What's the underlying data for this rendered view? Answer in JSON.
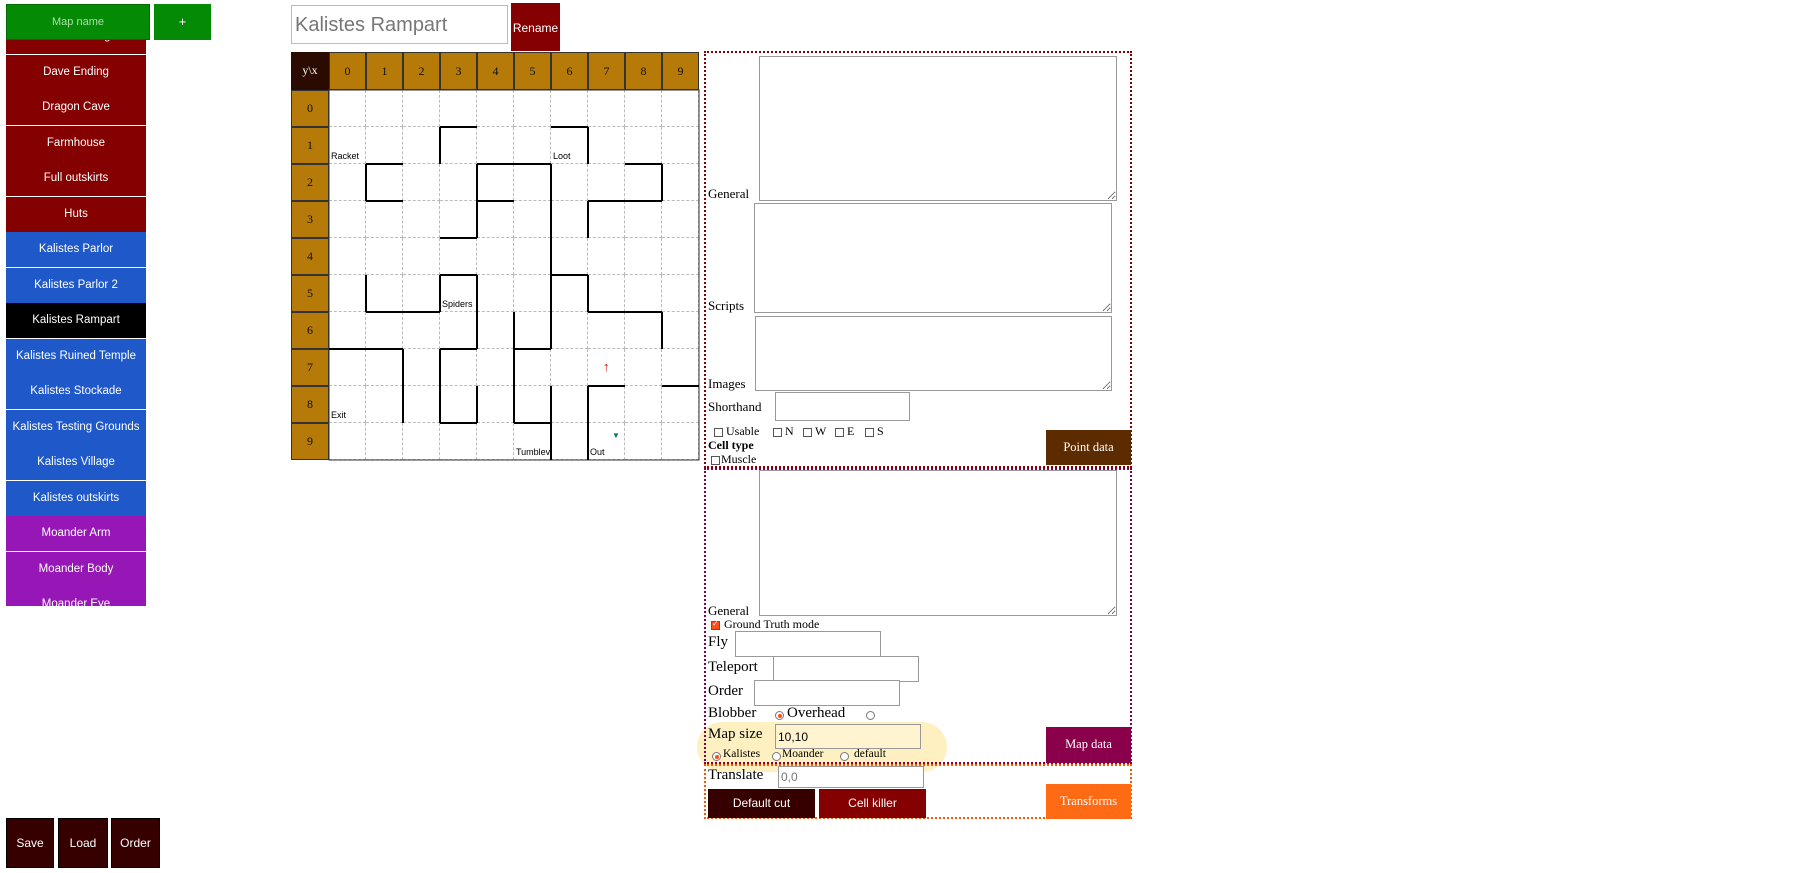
{
  "header": {
    "map_name_placeholder": "Map name",
    "add_label": "+",
    "map_title": "Kalistes Rampart",
    "rename_label": "Rename"
  },
  "map_list": [
    {
      "label": "Dave Challenge",
      "color": "red"
    },
    {
      "label": "Dave Ending",
      "color": "red"
    },
    {
      "label": "Dragon Cave",
      "color": "red"
    },
    {
      "label": "Farmhouse",
      "color": "red"
    },
    {
      "label": "Full outskirts",
      "color": "red"
    },
    {
      "label": "Huts",
      "color": "red"
    },
    {
      "label": "Kalistes Parlor",
      "color": "blue"
    },
    {
      "label": "Kalistes Parlor 2",
      "color": "blue"
    },
    {
      "label": "Kalistes Rampart",
      "color": "black",
      "selected": true
    },
    {
      "label": "Kalistes Ruined Temple",
      "color": "blue"
    },
    {
      "label": "Kalistes Stockade",
      "color": "blue"
    },
    {
      "label": "Kalistes Testing Grounds",
      "color": "blue"
    },
    {
      "label": "Kalistes Village",
      "color": "blue"
    },
    {
      "label": "Kalistes outskirts",
      "color": "blue"
    },
    {
      "label": "Moander Arm",
      "color": "purple"
    },
    {
      "label": "Moander Body",
      "color": "purple"
    },
    {
      "label": "Moander Eye",
      "color": "purple"
    }
  ],
  "bottom_buttons": {
    "save": "Save",
    "load": "Load",
    "order": "Order"
  },
  "grid": {
    "corner_label": "y\\x",
    "columns": [
      "0",
      "1",
      "2",
      "3",
      "4",
      "5",
      "6",
      "7",
      "8",
      "9"
    ],
    "rows": [
      "0",
      "1",
      "2",
      "3",
      "4",
      "5",
      "6",
      "7",
      "8",
      "9"
    ],
    "cell_labels": [
      {
        "x": 0,
        "y": 1,
        "text": "Racket"
      },
      {
        "x": 6,
        "y": 1,
        "text": "Loot"
      },
      {
        "x": 3,
        "y": 5,
        "text": "Spiders"
      },
      {
        "x": 0,
        "y": 8,
        "text": "Exit"
      },
      {
        "x": 5,
        "y": 9,
        "text": "Tumblev"
      },
      {
        "x": 7,
        "y": 9,
        "text": "Out"
      }
    ],
    "markers": [
      {
        "x": 7,
        "y": 7,
        "type": "arrow-up",
        "symbol": "↑",
        "color": "#e00000"
      },
      {
        "x": 7,
        "y": 9,
        "type": "arrow-down",
        "symbol": "▼",
        "color": "#0a7a4a"
      }
    ],
    "walls": [
      {
        "x": 3,
        "y": 1,
        "sides": [
          "N",
          "W"
        ]
      },
      {
        "x": 6,
        "y": 1,
        "sides": [
          "N",
          "E"
        ]
      },
      {
        "x": 1,
        "y": 2,
        "sides": [
          "N",
          "W"
        ]
      },
      {
        "x": 3,
        "y": 2,
        "sides": [
          "E"
        ]
      },
      {
        "x": 4,
        "y": 2,
        "sides": [
          "N"
        ]
      },
      {
        "x": 5,
        "y": 2,
        "sides": [
          "N"
        ]
      },
      {
        "x": 6,
        "y": 2,
        "sides": [
          "W"
        ]
      },
      {
        "x": 8,
        "y": 2,
        "sides": [
          "N",
          "E"
        ]
      },
      {
        "x": 1,
        "y": 3,
        "sides": [
          "N"
        ]
      },
      {
        "x": 3,
        "y": 3,
        "sides": [
          "E",
          "S"
        ]
      },
      {
        "x": 4,
        "y": 3,
        "sides": [
          "N"
        ]
      },
      {
        "x": 6,
        "y": 3,
        "sides": [
          "W"
        ]
      },
      {
        "x": 7,
        "y": 3,
        "sides": [
          "N",
          "W"
        ]
      },
      {
        "x": 8,
        "y": 3,
        "sides": [
          "N"
        ]
      },
      {
        "x": 6,
        "y": 4,
        "sides": [
          "W"
        ]
      },
      {
        "x": 1,
        "y": 5,
        "sides": [
          "W",
          "S"
        ]
      },
      {
        "x": 2,
        "y": 5,
        "sides": [
          "S"
        ]
      },
      {
        "x": 3,
        "y": 5,
        "sides": [
          "N",
          "W",
          "E"
        ]
      },
      {
        "x": 6,
        "y": 5,
        "sides": [
          "N",
          "W",
          "E"
        ]
      },
      {
        "x": 7,
        "y": 5,
        "sides": [
          "S"
        ]
      },
      {
        "x": 8,
        "y": 5,
        "sides": [
          "S"
        ]
      },
      {
        "x": 3,
        "y": 6,
        "sides": [
          "E",
          "S"
        ]
      },
      {
        "x": 5,
        "y": 6,
        "sides": [
          "W"
        ]
      },
      {
        "x": 6,
        "y": 6,
        "sides": [
          "W"
        ]
      },
      {
        "x": 8,
        "y": 6,
        "sides": [
          "E"
        ]
      },
      {
        "x": 0,
        "y": 7,
        "sides": [
          "N"
        ]
      },
      {
        "x": 1,
        "y": 7,
        "sides": [
          "N",
          "E"
        ]
      },
      {
        "x": 3,
        "y": 7,
        "sides": [
          "W",
          "N"
        ]
      },
      {
        "x": 5,
        "y": 7,
        "sides": [
          "W",
          "N"
        ]
      },
      {
        "x": 9,
        "y": 7,
        "sides": [
          "S"
        ]
      },
      {
        "x": 1,
        "y": 8,
        "sides": [
          "E"
        ]
      },
      {
        "x": 3,
        "y": 8,
        "sides": [
          "W",
          "S"
        ]
      },
      {
        "x": 4,
        "y": 8,
        "sides": [
          "W"
        ]
      },
      {
        "x": 5,
        "y": 8,
        "sides": [
          "W",
          "S"
        ]
      },
      {
        "x": 6,
        "y": 8,
        "sides": [
          "W"
        ]
      },
      {
        "x": 7,
        "y": 8,
        "sides": [
          "N",
          "W"
        ]
      },
      {
        "x": 7,
        "y": 9,
        "sides": [
          "W"
        ]
      },
      {
        "x": 6,
        "y": 9,
        "sides": [
          "W"
        ]
      }
    ]
  },
  "point_panel": {
    "general_label": "General",
    "scripts_label": "Scripts",
    "images_label": "Images",
    "shorthand_label": "Shorthand",
    "shorthand_value": "",
    "checkboxes": {
      "usable": "Usable",
      "n": "N",
      "w": "W",
      "e": "E",
      "s": "S"
    },
    "cell_type_label": "Cell type",
    "muscle_label": "Muscle",
    "button_label": "Point data",
    "button_color": "#5c2c00"
  },
  "map_panel": {
    "general_label": "General",
    "ground_truth_label": "Ground Truth mode",
    "ground_truth_checked": true,
    "fly_label": "Fly",
    "teleport_label": "Teleport",
    "order_label": "Order",
    "blobber_label": "Blobber",
    "overhead_label": "Overhead",
    "map_size_label": "Map size",
    "map_size_value": "10,10",
    "tilesets": [
      "Kalistes",
      "Moander",
      "default"
    ],
    "tileset_selected": "Kalistes",
    "button_label": "Map data",
    "button_color": "#8a004a"
  },
  "transform_panel": {
    "translate_label": "Translate",
    "translate_placeholder": "0,0",
    "default_cut_label": "Default cut",
    "cell_killer_label": "Cell killer",
    "button_label": "Transforms",
    "button_color": "#ff6a14"
  }
}
